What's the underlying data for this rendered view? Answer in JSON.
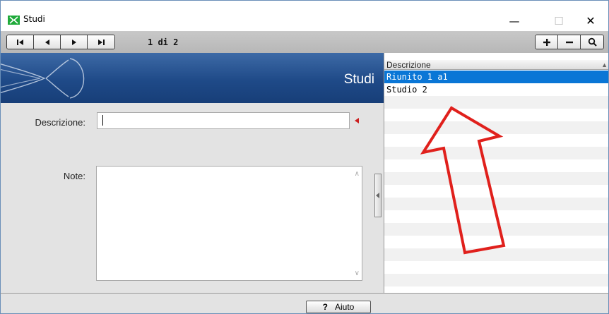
{
  "window": {
    "title": "Studi",
    "minimize_glyph": "—",
    "maximize_glyph": "☐",
    "close_glyph": "✕"
  },
  "toolbar": {
    "record_info": "1 di 2",
    "nav_buttons": [
      "first-record-icon",
      "prev-record-icon",
      "next-record-icon",
      "last-record-icon"
    ],
    "action_buttons": [
      "plus-icon",
      "minus-icon",
      "search-icon"
    ]
  },
  "form": {
    "banner_title": "Studi",
    "descrizione_label": "Descrizione:",
    "descrizione_value": "",
    "note_label": "Note:",
    "note_value": ""
  },
  "list": {
    "column_header": "Descrizione",
    "rows": [
      "Riunito 1 a1",
      "Studio 2"
    ],
    "selected_index": 0
  },
  "footer": {
    "help_icon": "?",
    "help_label": "Aiuto"
  },
  "colors": {
    "banner": "#1f4a88",
    "selection": "#0a76d6",
    "annotation_arrow": "#e0201c",
    "required_marker": "#cc1f1f"
  }
}
